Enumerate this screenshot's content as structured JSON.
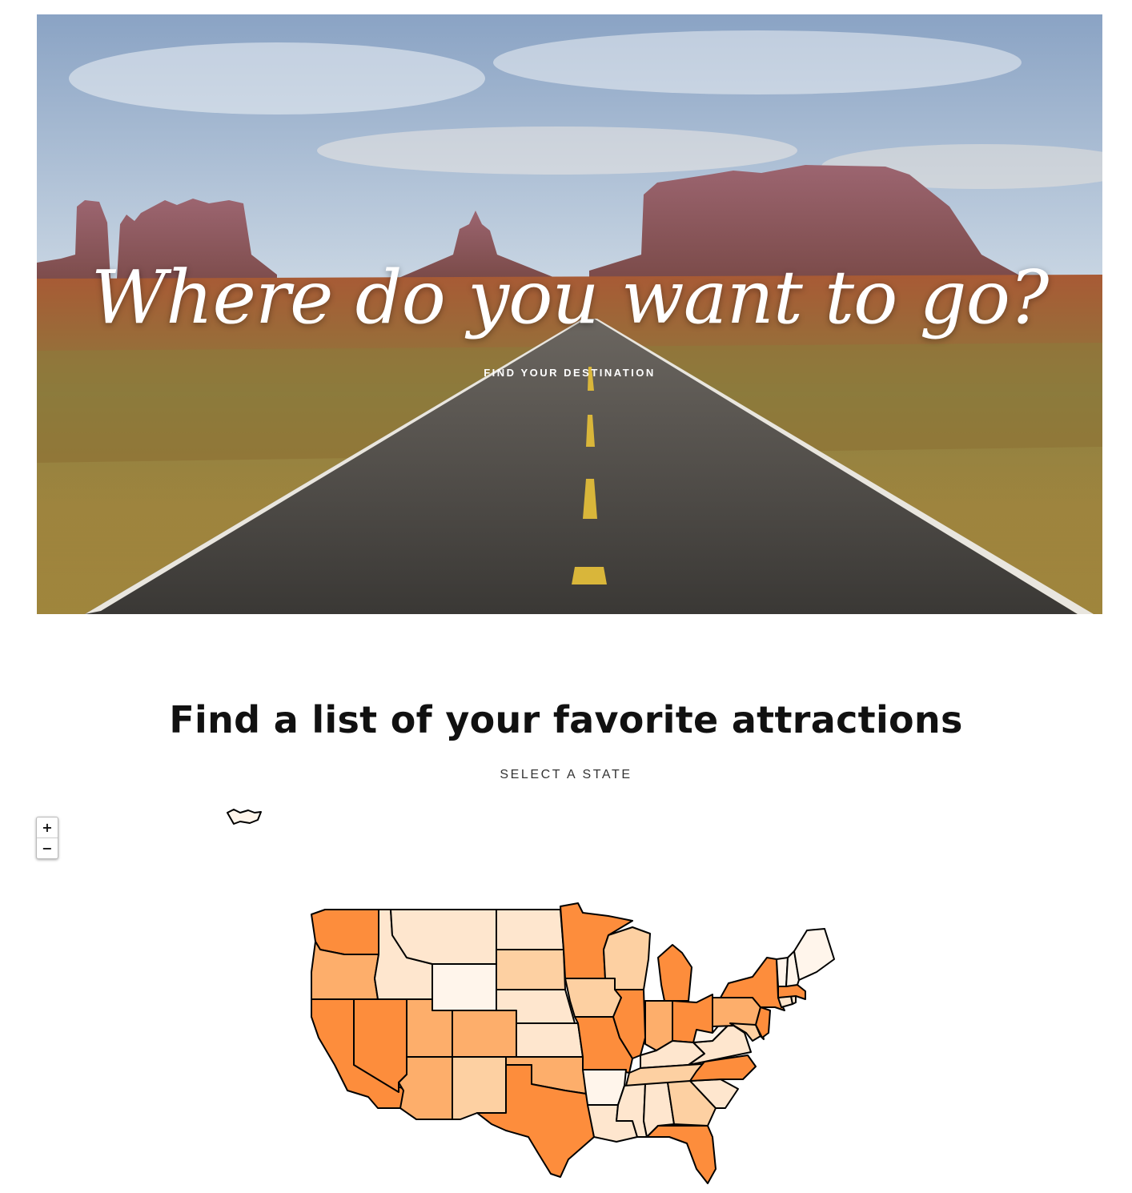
{
  "hero": {
    "title": "Where do you want to go?",
    "subtitle": "FIND YOUR DESTINATION"
  },
  "section": {
    "title": "Find a list of your favorite attractions",
    "subtitle": "SELECT A STATE"
  },
  "zoom": {
    "in_label": "+",
    "out_label": "−"
  },
  "colors": {
    "c1": "#fff5eb",
    "c2": "#fee6ce",
    "c3": "#fdd0a2",
    "c4": "#fdae6b",
    "c5": "#fd8d3c",
    "stroke": "#000000"
  },
  "map": {
    "states": [
      {
        "name": "Washington",
        "level": 5
      },
      {
        "name": "Oregon",
        "level": 4
      },
      {
        "name": "California",
        "level": 5
      },
      {
        "name": "Nevada",
        "level": 5
      },
      {
        "name": "Idaho",
        "level": 2
      },
      {
        "name": "Montana",
        "level": 2
      },
      {
        "name": "Wyoming",
        "level": 1
      },
      {
        "name": "Utah",
        "level": 4
      },
      {
        "name": "Colorado",
        "level": 4
      },
      {
        "name": "Arizona",
        "level": 4
      },
      {
        "name": "New Mexico",
        "level": 3
      },
      {
        "name": "North Dakota",
        "level": 2
      },
      {
        "name": "South Dakota",
        "level": 3
      },
      {
        "name": "Nebraska",
        "level": 2
      },
      {
        "name": "Kansas",
        "level": 2
      },
      {
        "name": "Oklahoma",
        "level": 4
      },
      {
        "name": "Texas",
        "level": 5
      },
      {
        "name": "Minnesota",
        "level": 5
      },
      {
        "name": "Iowa",
        "level": 3
      },
      {
        "name": "Missouri",
        "level": 5
      },
      {
        "name": "Arkansas",
        "level": 1
      },
      {
        "name": "Louisiana",
        "level": 2
      },
      {
        "name": "Wisconsin",
        "level": 3
      },
      {
        "name": "Illinois",
        "level": 5
      },
      {
        "name": "Michigan",
        "level": 5
      },
      {
        "name": "Indiana",
        "level": 4
      },
      {
        "name": "Ohio",
        "level": 5
      },
      {
        "name": "Kentucky",
        "level": 2
      },
      {
        "name": "Tennessee",
        "level": 3
      },
      {
        "name": "Mississippi",
        "level": 2
      },
      {
        "name": "Alabama",
        "level": 2
      },
      {
        "name": "Georgia",
        "level": 3
      },
      {
        "name": "Florida",
        "level": 5
      },
      {
        "name": "South Carolina",
        "level": 2
      },
      {
        "name": "North Carolina",
        "level": 5
      },
      {
        "name": "Virginia",
        "level": 2
      },
      {
        "name": "West Virginia",
        "level": 1
      },
      {
        "name": "Pennsylvania",
        "level": 4
      },
      {
        "name": "New York",
        "level": 5
      },
      {
        "name": "Maryland",
        "level": 3
      },
      {
        "name": "Delaware",
        "level": 2
      },
      {
        "name": "New Jersey",
        "level": 5
      },
      {
        "name": "Connecticut",
        "level": 2
      },
      {
        "name": "Rhode Island",
        "level": 2
      },
      {
        "name": "Massachusetts",
        "level": 5
      },
      {
        "name": "Vermont",
        "level": 1
      },
      {
        "name": "New Hampshire",
        "level": 1
      },
      {
        "name": "Maine",
        "level": 1
      },
      {
        "name": "Alaska",
        "level": 1
      }
    ]
  }
}
